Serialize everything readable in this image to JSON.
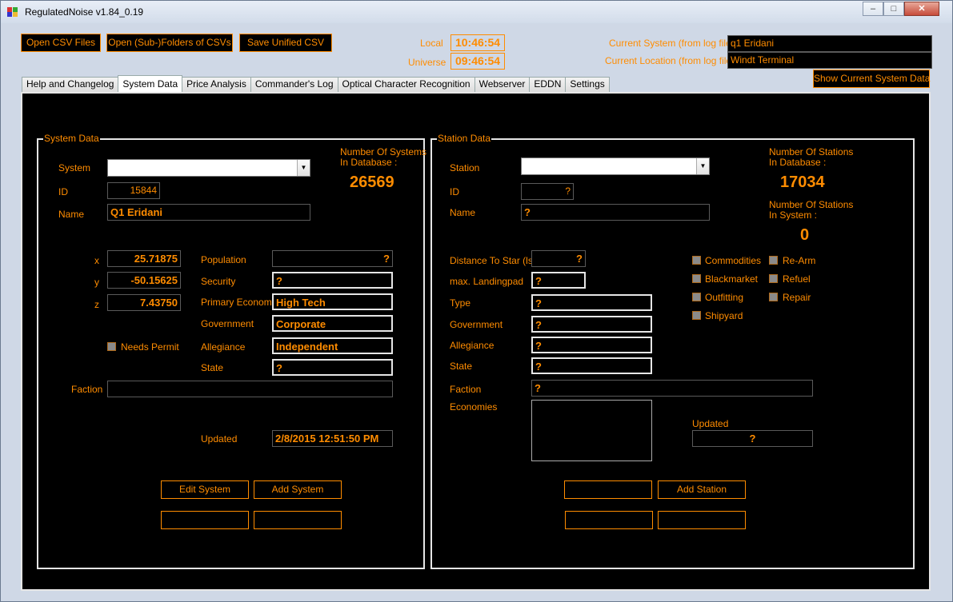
{
  "window": {
    "title": "RegulatedNoise v1.84_0.19",
    "minimize": "–",
    "maximize": "□",
    "close": "✕"
  },
  "toolbar": {
    "open_csv": "Open CSV Files",
    "open_folders": "Open (Sub-)Folders of CSVs",
    "save_unified": "Save Unified CSV"
  },
  "clocks": {
    "local_label": "Local",
    "local_time": "10:46:54",
    "universe_label": "Universe",
    "universe_time": "09:46:54"
  },
  "current": {
    "system_label": "Current System (from log files)",
    "system_value": "q1 Eridani",
    "location_label": "Current Location (from log files)",
    "location_value": "Windt Terminal",
    "show_button": "Show Current System Data"
  },
  "tabs": [
    {
      "label": "Help and Changelog"
    },
    {
      "label": "System Data"
    },
    {
      "label": "Price Analysis"
    },
    {
      "label": "Commander's Log"
    },
    {
      "label": "Optical Character Recognition"
    },
    {
      "label": "Webserver"
    },
    {
      "label": "EDDN"
    },
    {
      "label": "Settings"
    }
  ],
  "system": {
    "group_title": "System Data",
    "count_label_1": "Number Of Systems",
    "count_label_2": "In Database :",
    "count_value": "26569",
    "system_label": "System",
    "system_value": "",
    "id_label": "ID",
    "id_value": "15844",
    "name_label": "Name",
    "name_value": "Q1 Eridani",
    "x_label": "x",
    "x_value": "25.71875",
    "y_label": "y",
    "y_value": "-50.15625",
    "z_label": "z",
    "z_value": "7.43750",
    "needs_permit": "Needs Permit",
    "population_label": "Population",
    "population_value": "?",
    "security_label": "Security",
    "security_value": "?",
    "economy_label": "Primary Economy",
    "economy_value": "High Tech",
    "government_label": "Government",
    "government_value": "Corporate",
    "allegiance_label": "Allegiance",
    "allegiance_value": "Independent",
    "state_label": "State",
    "state_value": "?",
    "faction_label": "Faction",
    "faction_value": "",
    "updated_label": "Updated",
    "updated_value": "2/8/2015 12:51:50 PM",
    "edit_button": "Edit System",
    "add_button": "Add System",
    "blank_button_1": "",
    "blank_button_2": "",
    "blank_button_3": ""
  },
  "station": {
    "group_title": "Station Data",
    "count_label_1": "Number Of Stations",
    "count_label_2": "In Database :",
    "count_value": "17034",
    "insystem_label_1": "Number Of Stations",
    "insystem_label_2": "In System :",
    "insystem_value": "0",
    "station_label": "Station",
    "station_value": "",
    "id_label": "ID",
    "id_value": "?",
    "name_label": "Name",
    "name_value": "?",
    "distance_label": "Distance To Star (ls)",
    "distance_value": "?",
    "landingpad_label": "max. Landingpad",
    "landingpad_value": "?",
    "type_label": "Type",
    "type_value": "?",
    "government_label": "Government",
    "government_value": "?",
    "allegiance_label": "Allegiance",
    "allegiance_value": "?",
    "state_label": "State",
    "state_value": "?",
    "faction_label": "Faction",
    "faction_value": "?",
    "economies_label": "Economies",
    "updated_label": "Updated",
    "updated_value": "?",
    "services": {
      "commodities": "Commodities",
      "blackmarket": "Blackmarket",
      "outfitting": "Outfitting",
      "shipyard": "Shipyard",
      "rearm": "Re-Arm",
      "refuel": "Refuel",
      "repair": "Repair"
    },
    "add_button": "Add Station",
    "blank_button_1": "",
    "blank_button_2": "",
    "blank_button_3": ""
  },
  "dropdown_icon": "chevron-down-icon"
}
